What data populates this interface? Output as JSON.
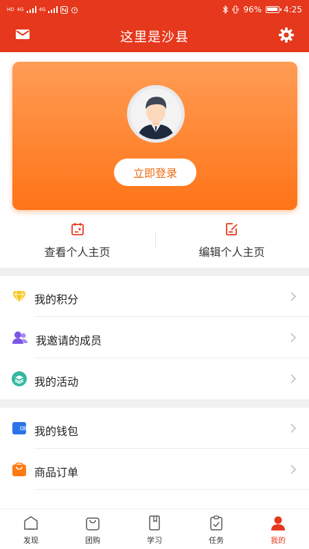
{
  "status_bar": {
    "left_chips": [
      "HD",
      "4G",
      "4G"
    ],
    "battery": "96%",
    "battery_level": 0.96,
    "time": "4:25"
  },
  "header": {
    "title": "这里是沙县",
    "left_icon": "mail-icon",
    "right_icon": "gear-icon"
  },
  "profile_card": {
    "avatar_icon": "user-avatar-icon",
    "login_label": "立即登录"
  },
  "profile_actions": [
    {
      "label": "查看个人主页",
      "icon": "id-card-icon"
    },
    {
      "label": "编辑个人主页",
      "icon": "edit-note-icon"
    }
  ],
  "menu_group_1": [
    {
      "label": "我的积分",
      "icon": "diamond-icon"
    },
    {
      "label": "我邀请的成员",
      "icon": "members-icon"
    },
    {
      "label": "我的活动",
      "icon": "layers-icon"
    }
  ],
  "menu_group_2": [
    {
      "label": "我的钱包",
      "icon": "wallet-icon"
    },
    {
      "label": "商品订单",
      "icon": "shopping-bag-icon"
    }
  ],
  "bottom_nav": [
    {
      "label": "发现",
      "icon": "discover-icon",
      "active": false
    },
    {
      "label": "团购",
      "icon": "group-buy-icon",
      "active": false
    },
    {
      "label": "学习",
      "icon": "study-icon",
      "active": false
    },
    {
      "label": "任务",
      "icon": "task-icon",
      "active": false
    },
    {
      "label": "我的",
      "icon": "me-icon",
      "active": true
    }
  ],
  "colors": {
    "brand_red": "#e5381c",
    "card_top": "#ff9c55",
    "card_bottom": "#ff7417",
    "login_text": "#ef6b12"
  }
}
